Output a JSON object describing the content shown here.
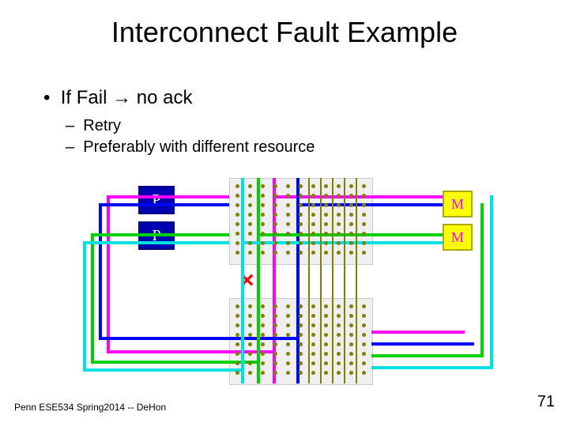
{
  "slide": {
    "title": "Interconnect Fault Example",
    "bullet_main": "If Fail → no ack",
    "bullet_sub1": "Retry",
    "bullet_sub2": "Preferably with different resource",
    "footer": "Penn ESE534 Spring2014 -- DeHon",
    "page_number": "71"
  },
  "diagram": {
    "p_label": "P",
    "m_label": "M",
    "fault_mark": "×",
    "colors": {
      "route_magenta": "#ff00ff",
      "route_blue": "#0000ff",
      "route_green": "#00d000",
      "route_cyan": "#00e0e0",
      "grid": "#808000"
    }
  }
}
